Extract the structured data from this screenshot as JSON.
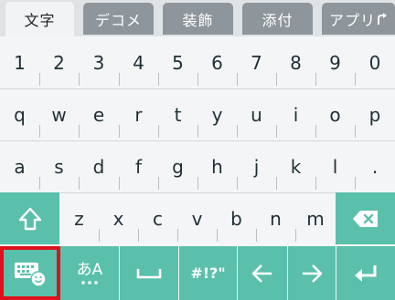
{
  "tabs": [
    {
      "label": "文字",
      "active": true
    },
    {
      "label": "デコメ",
      "active": false
    },
    {
      "label": "装飾",
      "active": false
    },
    {
      "label": "添付",
      "active": false
    },
    {
      "label": "アプリ",
      "active": false
    }
  ],
  "rows": {
    "numbers": [
      "1",
      "2",
      "3",
      "4",
      "5",
      "6",
      "7",
      "8",
      "9",
      "0"
    ],
    "top": [
      "q",
      "w",
      "e",
      "r",
      "t",
      "y",
      "u",
      "i",
      "o",
      "p"
    ],
    "middle": [
      "a",
      "s",
      "d",
      "f",
      "g",
      "h",
      "j",
      "k",
      "l",
      "."
    ],
    "bottom": [
      "z",
      "x",
      "c",
      "v",
      "b",
      "n",
      "m"
    ]
  },
  "function_keys": {
    "shift_icon": "shift-arrow-icon",
    "backspace_icon": "backspace-icon",
    "keyboard_settings_icon": "keyboard-smiley-icon",
    "kana_label": "あA",
    "space_icon": "space-bracket-icon",
    "symbols_label": "#!?\"",
    "left_icon": "arrow-left-icon",
    "right_icon": "arrow-right-icon",
    "enter_icon": "enter-icon"
  },
  "colors": {
    "accent_teal": "#5bc0ab",
    "highlight_red": "#e0111b",
    "tab_inactive": "#8f969b",
    "key_background": "#f3f5f6"
  }
}
